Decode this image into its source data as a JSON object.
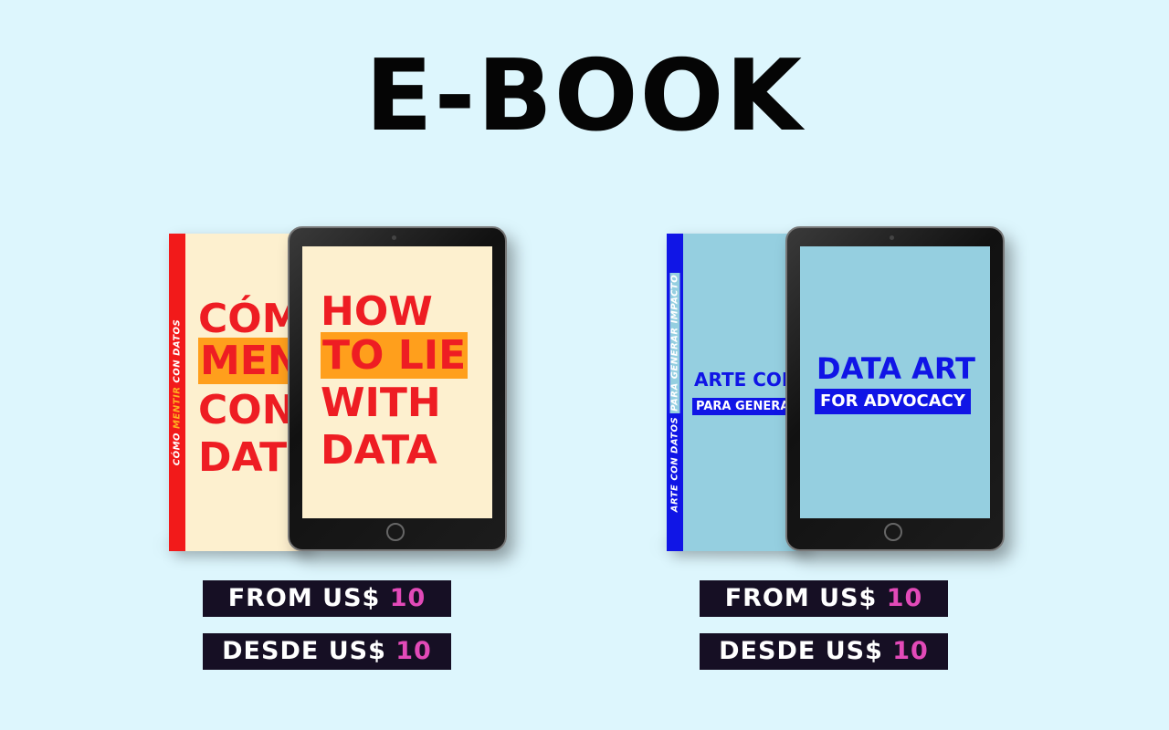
{
  "header": {
    "title": "E-BOOK"
  },
  "products": [
    {
      "book_spine_pre": "CÓMO",
      "book_spine_highlight": "MENTIR",
      "book_spine_post": "CON DATOS",
      "book_lines": [
        "CÓM",
        "MENT",
        "CON",
        "DATO"
      ],
      "tablet_lines": [
        "HOW",
        "TO LIE",
        "WITH",
        "DATA"
      ],
      "price_from": {
        "label": "FROM US$",
        "amount": "10"
      },
      "price_desde": {
        "label": "DESDE US$",
        "amount": "10"
      },
      "colors": {
        "cover": "#fdf0cf",
        "spine": "#f21a1a",
        "text": "#ee1d23",
        "highlight": "#ff9f1c"
      }
    },
    {
      "book_spine_pre": "ARTE CON DATOS",
      "book_spine_highlight": "PARA GENERAR IMPACTO",
      "book_lines": [
        "ARTE CON",
        "PARA GENERAR"
      ],
      "tablet_lines": [
        "DATA ART",
        "FOR ADVOCACY"
      ],
      "price_from": {
        "label": "FROM US$",
        "amount": "10"
      },
      "price_desde": {
        "label": "DESDE US$",
        "amount": "10"
      },
      "colors": {
        "cover": "#95cfe0",
        "spine": "#1015e6",
        "text": "#1015e6",
        "highlight": "#1015e6"
      }
    }
  ]
}
